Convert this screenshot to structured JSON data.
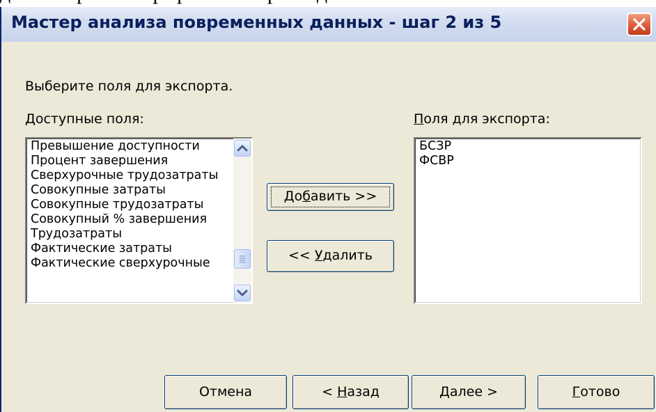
{
  "document_text": "для построения графика выбирают два поля – БСЗР и ФСВР",
  "dialog": {
    "title": "Мастер анализа повременных данных - шаг 2 из 5",
    "instruction": "Выберите поля для экспорта.",
    "available": {
      "label_prefix": "",
      "label_accel": "Д",
      "label_rest": "оступные поля:",
      "items": [
        "Превышение доступности",
        "Процент завершения",
        "Сверхурочные трудозатраты",
        "Совокупные затраты",
        "Совокупные трудозатраты",
        "Совокупный % завершения",
        "Трудозатраты",
        "Фактические затраты",
        "Фактические сверхурочные"
      ]
    },
    "export": {
      "label_accel": "П",
      "label_rest": "оля для экспорта:",
      "items": [
        "БСЗР",
        "ФСВР"
      ]
    },
    "buttons": {
      "add_pre": "До",
      "add_accel": "б",
      "add_post": "авить >>",
      "remove_pre": "<< ",
      "remove_accel": "У",
      "remove_post": "далить",
      "cancel": "Отмена",
      "back_pre": "< ",
      "back_accel": "Н",
      "back_post": "азад",
      "next_accel": "Д",
      "next_post": "алее >",
      "finish_accel": "Г",
      "finish_post": "отово"
    },
    "icons": {
      "close": "close-icon",
      "scroll_up": "arrow-up-icon",
      "scroll_down": "arrow-down-icon",
      "scroll_thumb": "grip-icon"
    },
    "colors": {
      "dialog_bg": "#ece9d8",
      "title_text": "#0a1f5c",
      "close_button": "#e06040",
      "button_border": "#003c74"
    }
  }
}
